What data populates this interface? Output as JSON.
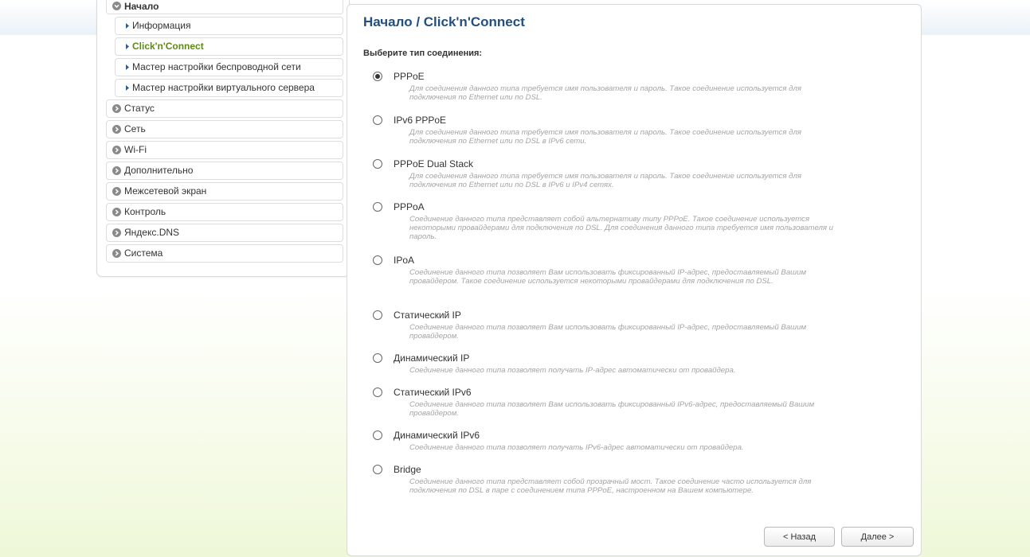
{
  "sidebar": {
    "items": [
      {
        "label": "Начало",
        "icon": "circle-chevron-down-icon"
      },
      {
        "label": "Информация",
        "icon": "triangle-right-icon"
      },
      {
        "label": "Click'n'Connect",
        "icon": "triangle-right-icon",
        "active": true
      },
      {
        "label": "Мастер настройки беспроводной сети",
        "icon": "triangle-right-icon"
      },
      {
        "label": "Мастер настройки виртуального сервера",
        "icon": "triangle-right-icon"
      },
      {
        "label": "Статус",
        "icon": "circle-chevron-right-icon"
      },
      {
        "label": "Сеть",
        "icon": "circle-chevron-right-icon"
      },
      {
        "label": "Wi-Fi",
        "icon": "circle-chevron-right-icon"
      },
      {
        "label": "Дополнительно",
        "icon": "circle-chevron-right-icon"
      },
      {
        "label": "Межсетевой экран",
        "icon": "circle-chevron-right-icon"
      },
      {
        "label": "Контроль",
        "icon": "circle-chevron-right-icon"
      },
      {
        "label": "Яндекс.DNS",
        "icon": "circle-chevron-right-icon"
      },
      {
        "label": "Система",
        "icon": "circle-chevron-right-icon"
      }
    ]
  },
  "main": {
    "title": "Начало /  Click'n'Connect",
    "section_label": "Выберите тип соединения:",
    "selected": "PPPoE",
    "options": [
      {
        "label": "PPPoE",
        "desc": "Для соединения данного типа требуется имя пользователя и пароль. Такое соединение используется для подключения по Ethernet или по DSL."
      },
      {
        "label": "IPv6 PPPoE",
        "desc": "Для соединения данного типа требуется имя пользователя и пароль. Такое соединение используется для подключения по Ethernet или по DSL в IPv6 сети."
      },
      {
        "label": "PPPoE Dual Stack",
        "desc": "Для соединения данного типа требуется имя пользователя и пароль. Такое соединение используется для подключения по Ethernet или по DSL в IPv6 и IPv4 сетях."
      },
      {
        "label": "PPPoA",
        "desc": "Соединение данного типа представляет собой альтернативу типу PPPoE. Такое соединение используется некоторыми провайдерами для подключения по DSL. Для соединения данного типа требуется имя пользователя и пароль."
      },
      {
        "label": "IPoA",
        "desc": "Соединение данного типа позволяет Вам использовать фиксированный IP-адрес, предоставляемый Вашим провайдером. Такое соединение используется некоторыми провайдерами для подключения по DSL."
      },
      {
        "label": "Статический IP",
        "desc": "Соединение данного типа позволяет Вам использовать фиксированный IP-адрес, предоставляемый Вашим провайдером."
      },
      {
        "label": "Динамический IP",
        "desc": "Соединение данного типа позволяет получать IP-адрес автоматически от провайдера."
      },
      {
        "label": "Статический IPv6",
        "desc": "Соединение данного типа позволяет Вам использовать фиксированный IPv6-адрес, предоставляемый Вашим провайдером."
      },
      {
        "label": "Динамический IPv6",
        "desc": "Соединение данного типа позволяет получать IPv6-адрес автоматически от провайдера."
      },
      {
        "label": "Bridge",
        "desc": "Соединение данного типа представляет собой прозрачный мост. Такое соединение часто используется для подключения по DSL в паре с соединением типа PPPoE, настроенном на Вашем компьютере."
      }
    ],
    "buttons": {
      "back_label": "< Назад",
      "next_label": "Далее >"
    }
  },
  "colors": {
    "title": "#254f7a",
    "active_menu": "#5d8a14",
    "description": "#a4a4a4"
  }
}
